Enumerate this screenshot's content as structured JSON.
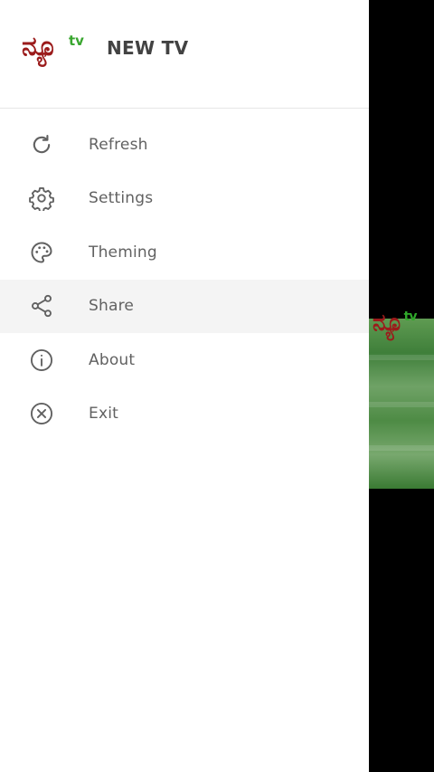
{
  "app": {
    "logo_main": "ನ್ಯೂ",
    "logo_tv": "tv",
    "title": "NEW TV"
  },
  "menu": {
    "items": [
      {
        "label": "Refresh",
        "icon": "refresh-icon"
      },
      {
        "label": "Settings",
        "icon": "gear-icon"
      },
      {
        "label": "Theming",
        "icon": "palette-icon"
      },
      {
        "label": "Share",
        "icon": "share-icon",
        "selected": true
      },
      {
        "label": "About",
        "icon": "info-icon"
      },
      {
        "label": "Exit",
        "icon": "close-circle-icon"
      }
    ]
  },
  "background": {
    "logo_main": "ನ್ಯೂ",
    "logo_tv": "tv"
  },
  "colors": {
    "logo_red": "#9b1b1b",
    "logo_green": "#39a62f",
    "text": "#616161",
    "selected_bg": "#f4f4f4"
  }
}
